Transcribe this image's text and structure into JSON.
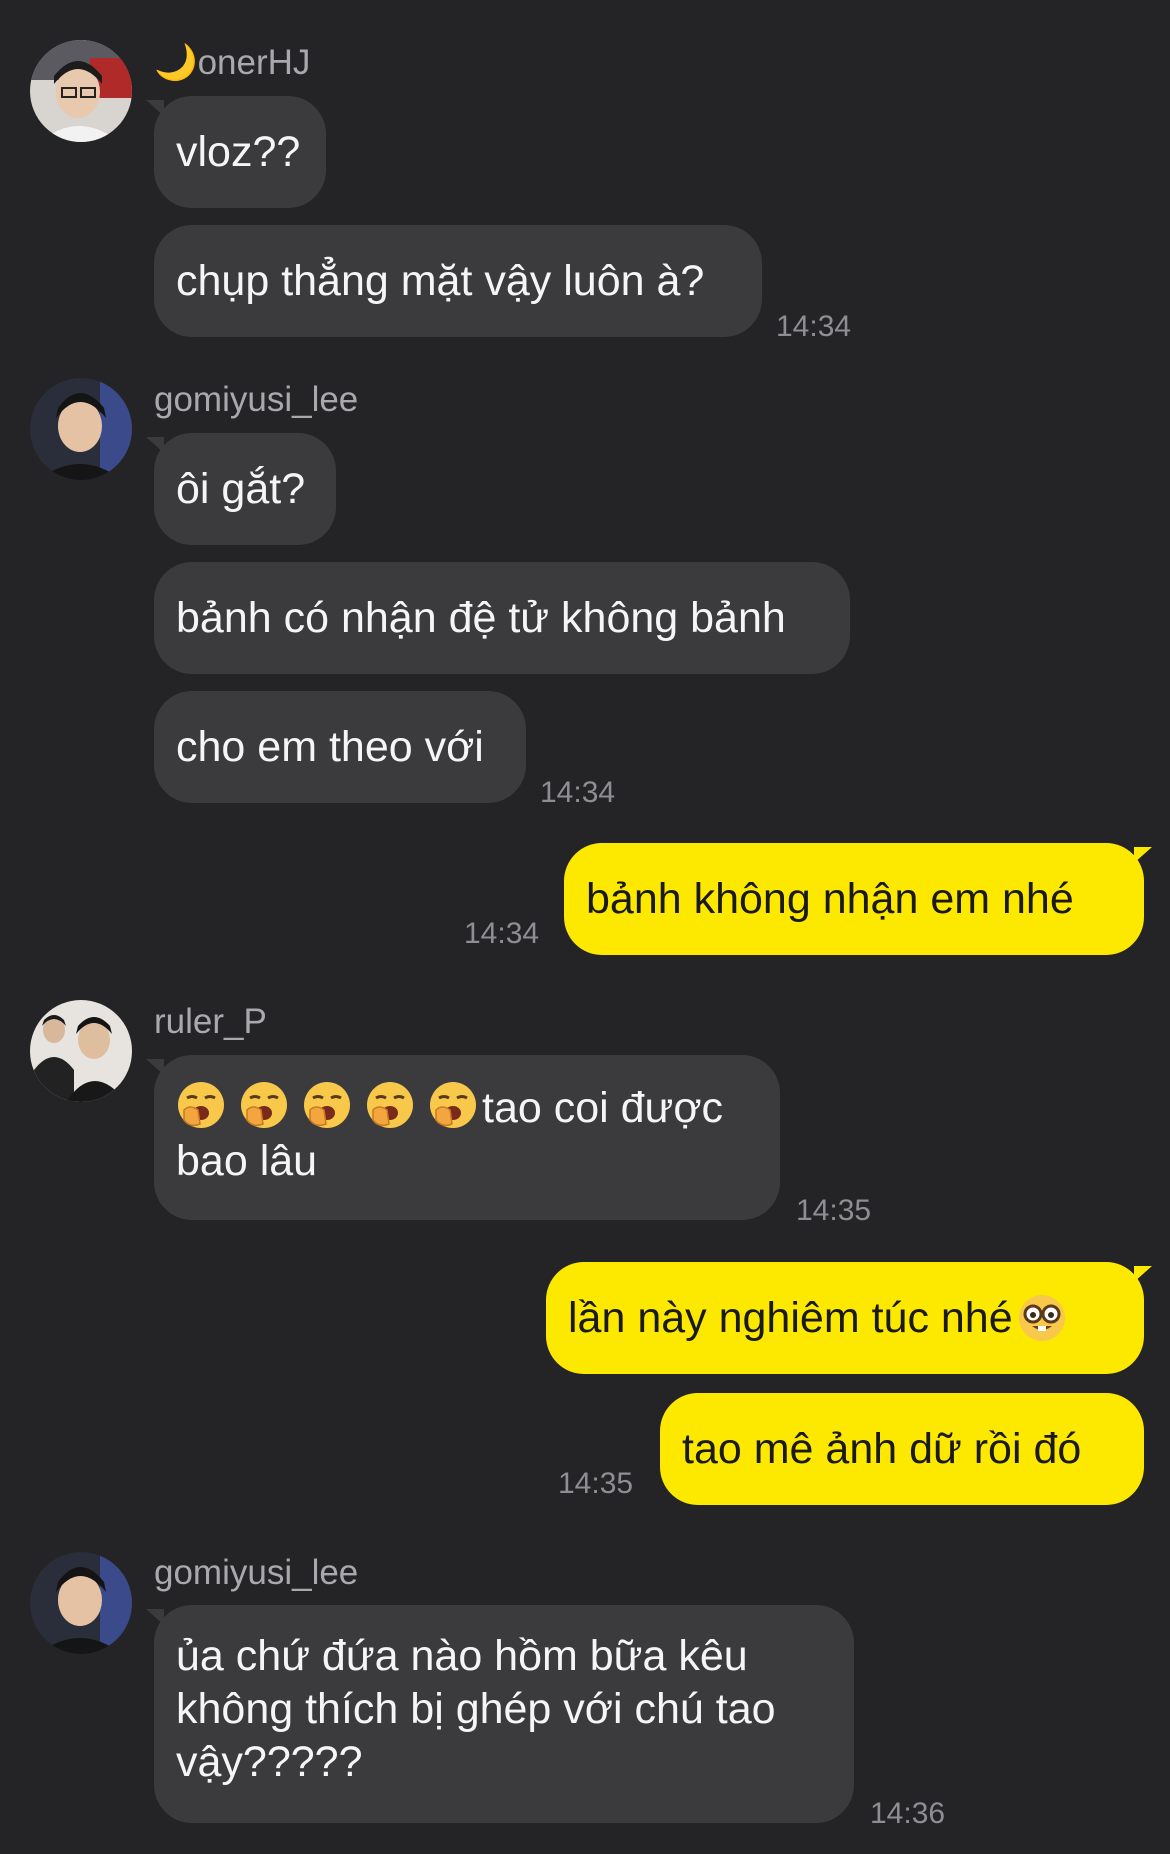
{
  "groups": [
    {
      "sender": "🌙onerHJ",
      "messages": [
        "vloz??",
        "chụp thẳng mặt vậy luôn à?"
      ],
      "time": "14:34"
    },
    {
      "sender": "gomiyusi_lee",
      "messages": [
        "ôi gắt?",
        "bảnh có nhận đệ tử không bảnh",
        "cho em theo với"
      ],
      "time": "14:34"
    },
    {
      "mine": true,
      "messages": [
        "bảnh không nhận em nhé"
      ],
      "time": "14:34"
    },
    {
      "sender": "ruler_P",
      "messages": [
        {
          "emoji_count": 5,
          "emoji": "yawning-face",
          "text_line1": "tao coi được",
          "text_line2": "bao lâu"
        }
      ],
      "time": "14:35"
    },
    {
      "mine": true,
      "messages": [
        {
          "text": "lần này nghiêm túc nhé",
          "emoji": "nerd-face"
        },
        "tao mê ảnh dữ rồi đó"
      ],
      "time": "14:35"
    },
    {
      "sender": "gomiyusi_lee",
      "messages": [
        {
          "lines": [
            "ủa chứ đứa nào hồm bữa kêu",
            "không thích bị ghép với chú tao",
            "vậy?????"
          ]
        }
      ],
      "time": "14:36"
    }
  ],
  "colors": {
    "background": "#242426",
    "incoming_bubble": "#3b3b3e",
    "outgoing_bubble": "#fde900",
    "sender_name": "#a9a9ad",
    "timestamp": "#8e8e93"
  }
}
